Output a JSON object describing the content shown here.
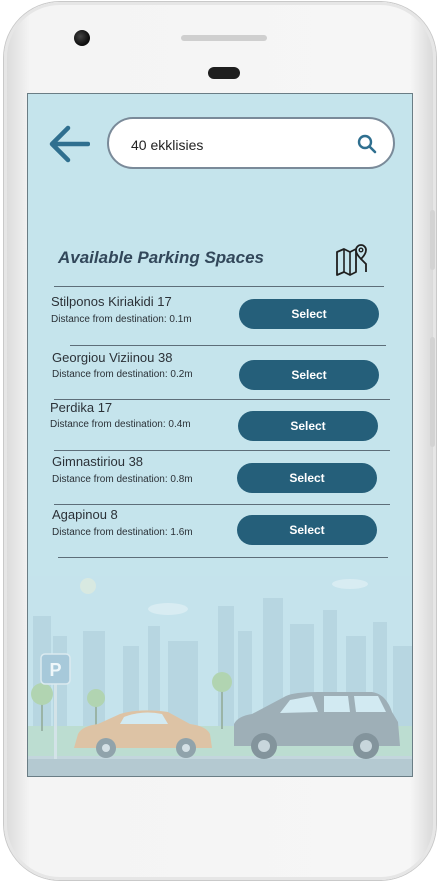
{
  "search": {
    "value": "40 ekklisies"
  },
  "list": {
    "title": "Available Parking Spaces",
    "items": [
      {
        "street": "Stilponos Kiriakidi 17",
        "distance": "Distance from destination: 0.1m",
        "button": "Select"
      },
      {
        "street": "Georgiou Viziinou 38",
        "distance": "Distance from destination: 0.2m",
        "button": "Select"
      },
      {
        "street": "Perdika 17",
        "distance": "Distance from destination: 0.4m",
        "button": "Select"
      },
      {
        "street": "Gimnastiriou 38",
        "distance": "Distance from destination: 0.8m",
        "button": "Select"
      },
      {
        "street": "Agapinou 8",
        "distance": "Distance from destination: 1.6m",
        "button": "Select"
      }
    ]
  },
  "parking_sign": {
    "letter": "P"
  },
  "colors": {
    "screen_bg": "#c5e4ec",
    "accent": "#255f7a",
    "back_arrow": "#2f6f8f"
  },
  "icons": [
    "back-arrow-icon",
    "search-icon",
    "map-pin-icon",
    "parking-sign-icon"
  ]
}
